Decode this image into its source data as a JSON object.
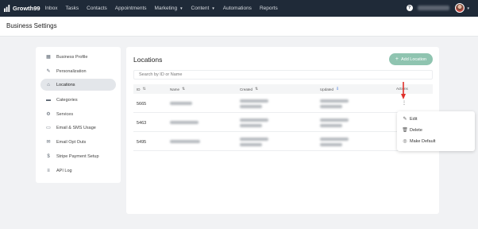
{
  "app": {
    "brand": "Growth99"
  },
  "topnav": {
    "items": [
      {
        "label": "Inbox",
        "dropdown": false
      },
      {
        "label": "Tasks",
        "dropdown": false
      },
      {
        "label": "Contacts",
        "dropdown": false
      },
      {
        "label": "Appointments",
        "dropdown": false
      },
      {
        "label": "Marketing",
        "dropdown": true
      },
      {
        "label": "Content",
        "dropdown": true
      },
      {
        "label": "Automations",
        "dropdown": false
      },
      {
        "label": "Reports",
        "dropdown": false
      }
    ],
    "help_glyph": "?"
  },
  "page": {
    "title": "Business Settings"
  },
  "sidebar": {
    "items": [
      {
        "label": "Business Profile",
        "icon": "building-icon"
      },
      {
        "label": "Personalization",
        "icon": "paint-icon"
      },
      {
        "label": "Locations",
        "icon": "location-icon",
        "active": true
      },
      {
        "label": "Categories",
        "icon": "folder-icon"
      },
      {
        "label": "Services",
        "icon": "gear-icon"
      },
      {
        "label": "Email & SMS Usage",
        "icon": "chat-icon"
      },
      {
        "label": "Email Opt Outs",
        "icon": "mail-icon"
      },
      {
        "label": "Stripe Payment Setup",
        "icon": "dollar-icon"
      },
      {
        "label": "API Log",
        "icon": "code-icon"
      }
    ]
  },
  "locations": {
    "title": "Locations",
    "add_button": "Add Location",
    "search_placeholder": "Search by ID or Name",
    "columns": {
      "id": "ID",
      "name": "Name",
      "created": "Created",
      "updated": "Updated",
      "actions": "Actions"
    },
    "rows": [
      {
        "id": "5665"
      },
      {
        "id": "5463"
      },
      {
        "id": "5495"
      }
    ]
  },
  "dropdown": {
    "items": [
      {
        "label": "Edit",
        "icon": "pencil-icon"
      },
      {
        "label": "Delete",
        "icon": "trash-icon"
      },
      {
        "label": "Make Default",
        "icon": "target-icon"
      }
    ]
  },
  "colors": {
    "nav_bg": "#1f2a38",
    "accent_green": "#8fc4b0",
    "annotation_red": "#e0312b",
    "sort_active": "#2563d6"
  }
}
